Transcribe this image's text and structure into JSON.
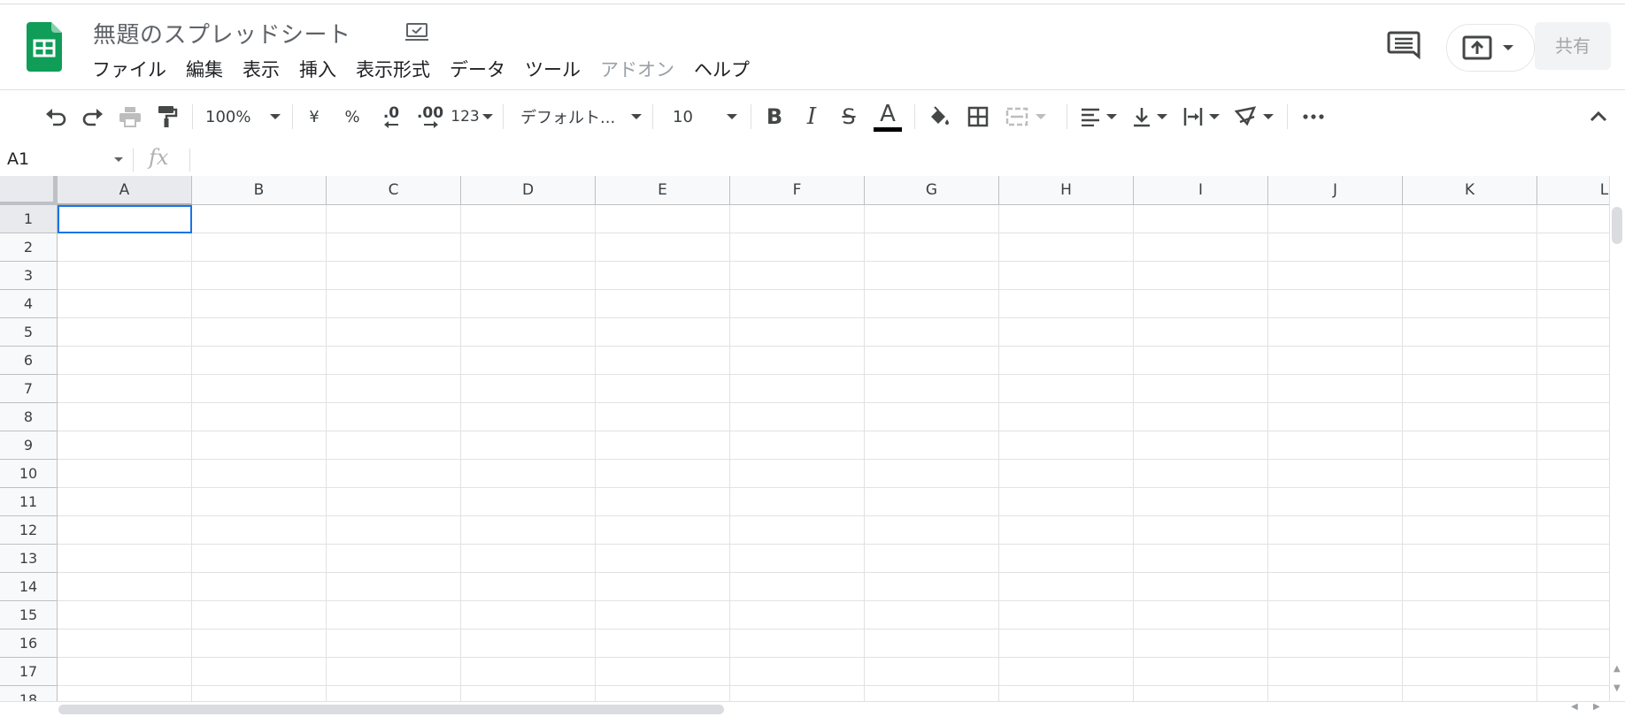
{
  "document": {
    "title": "無題のスプレッドシート",
    "drive_status_icon": "saved-to-drive-icon"
  },
  "menu": [
    {
      "label": "ファイル",
      "enabled": true
    },
    {
      "label": "編集",
      "enabled": true
    },
    {
      "label": "表示",
      "enabled": true
    },
    {
      "label": "挿入",
      "enabled": true
    },
    {
      "label": "表示形式",
      "enabled": true
    },
    {
      "label": "データ",
      "enabled": true
    },
    {
      "label": "ツール",
      "enabled": true
    },
    {
      "label": "アドオン",
      "enabled": false
    },
    {
      "label": "ヘルプ",
      "enabled": true
    }
  ],
  "header_actions": {
    "share_label": "共有",
    "comments_icon": "comments-icon",
    "present_icon": "present-to-meeting-icon"
  },
  "toolbar": {
    "zoom": "100%",
    "currency": "¥",
    "percent": "%",
    "decrease_decimal": ".0",
    "increase_decimal": ".00",
    "more_formats": "123",
    "font_family": "デフォルト...",
    "font_size": "10",
    "text_color": "#000000"
  },
  "formula_bar": {
    "name_box": "A1",
    "fx_label": "fx",
    "formula": ""
  },
  "grid": {
    "columns": [
      "A",
      "B",
      "C",
      "D",
      "E",
      "F",
      "G",
      "H",
      "I",
      "J",
      "K",
      "L"
    ],
    "rows": [
      "1",
      "2",
      "3",
      "4",
      "5",
      "6",
      "7",
      "8",
      "9",
      "10",
      "11",
      "12",
      "13",
      "14",
      "15",
      "16",
      "17",
      "18"
    ],
    "selected_cell": "A1"
  },
  "colors": {
    "brand_green": "#0f9d58",
    "selection_blue": "#1a73e8"
  }
}
